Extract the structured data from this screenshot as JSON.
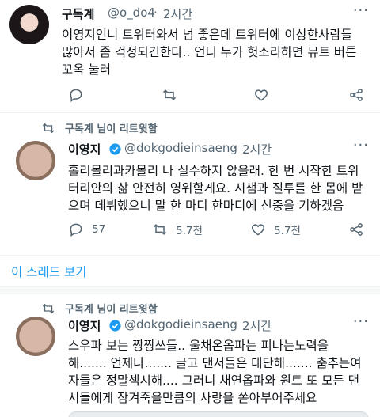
{
  "tweet1": {
    "name": "구독계",
    "handle": "@o_do4",
    "dot": "·",
    "time": "2시간",
    "more": "···",
    "lines": [
      "이영지언니 트위터와서 넘 좋은데 트위터에 이상한사람들",
      "많아서 좀 걱정되긴한다.. 언니 누가 헛소리하면 뮤트 버튼",
      "꼬옥 눌러"
    ]
  },
  "retweet_note": {
    "text": "구독계 님이 리트윗함"
  },
  "tweet2": {
    "name": "이영지",
    "handle": "@dokgodieinsaeng",
    "dot": "·",
    "time": "2시간",
    "more": "···",
    "lines": [
      "홀리몰리과카몰리 나 실수하지 않을래. 한 번 시작한 트위",
      "터리안의 삶 안전히 영위할게요. 시샘과 질투를 한 몸에 받",
      "으며 데뷔했으니 말 한 마디 한마디에 신중을 기하겠음"
    ],
    "reply_count": "57",
    "retweet_count": "5.7천",
    "like_count": "5.7천"
  },
  "thread_link": "이 스레드 보기",
  "retweet_note2": {
    "text": "구독계 님이 리트윗함"
  },
  "tweet3": {
    "name": "이영지",
    "handle": "@dokgodieinsaeng",
    "dot": "·",
    "time": "2시간",
    "more": "···",
    "lines": [
      "스우파 보는 짱짱쓰들.. 울채온옵파는 피나는노력을",
      "해....... 언제나....... 글고 댄서들은 대단해....... 춤추는여",
      "자들은 정말섹시해.... 그러니 채연옵파와 원트 또 모든 댄",
      "서들에게 잠겨죽을만큼의 사랑을 쏟아부어주세요"
    ]
  },
  "colors": {
    "accent": "#1d9bf0",
    "secondary_text": "#536471",
    "primary_text": "#0f1419"
  },
  "icons": [
    "reply-icon",
    "retweet-icon",
    "like-icon",
    "share-icon",
    "verified-badge-icon",
    "more-icon"
  ]
}
